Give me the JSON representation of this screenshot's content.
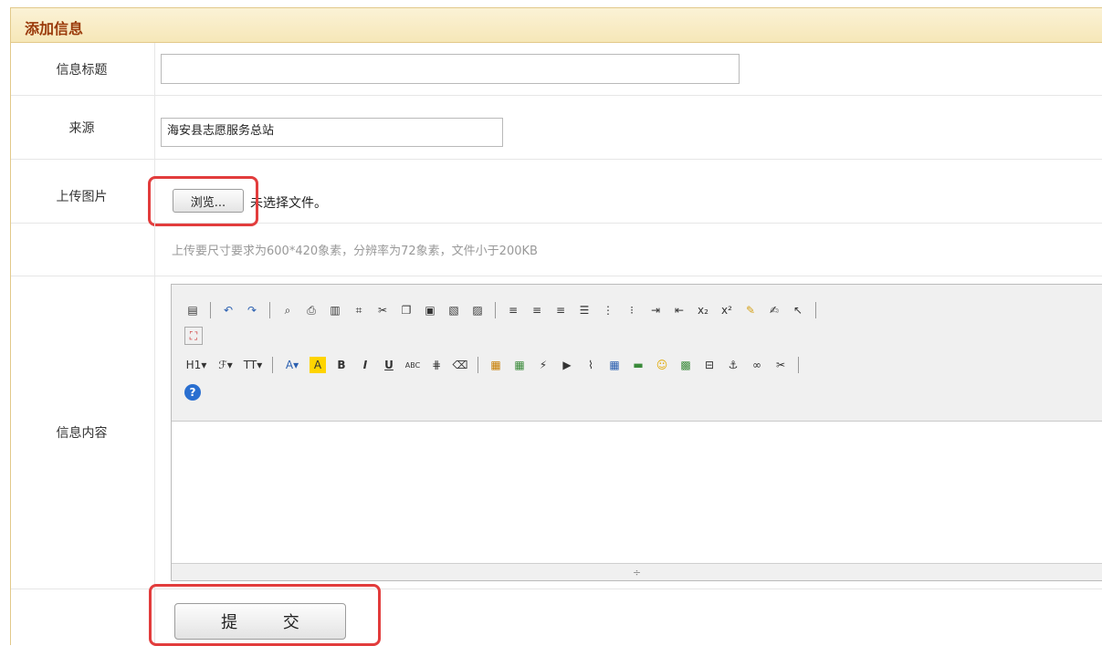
{
  "panel": {
    "title": "添加信息"
  },
  "form": {
    "title_label": "信息标题",
    "title_value": "",
    "source_label": "来源",
    "source_value": "海安县志愿服务总站",
    "upload_label": "上传图片",
    "browse_label": "浏览...",
    "file_status": "未选择文件。",
    "upload_hint": "上传要尺寸要求为600*420象素，分辨率为72象素，文件小于200KB",
    "content_label": "信息内容",
    "submit_label": "提 交"
  },
  "editor": {
    "toolbar_row1": [
      "source-icon",
      "undo-icon",
      "redo-icon",
      "preview-icon",
      "print-icon",
      "template-icon",
      "code-icon",
      "cut-icon",
      "copy-icon",
      "paste-icon",
      "paste-text-icon",
      "paste-word-icon",
      "align-left-icon",
      "align-center-icon",
      "align-right-icon",
      "justify-icon",
      "ordered-list-icon",
      "unordered-list-icon",
      "indent-icon",
      "outdent-icon",
      "subscript-icon",
      "superscript-icon",
      "clear-format-icon",
      "select-all-icon",
      "cursor-icon"
    ],
    "toolbar_row2": [
      "fullscreen-icon"
    ],
    "toolbar_row3": [
      "heading-icon",
      "font-family-icon",
      "font-size-icon",
      "font-color-icon",
      "highlight-color-icon",
      "bold-icon",
      "italic-icon",
      "underline-icon",
      "strikethrough-icon",
      "line-height-icon",
      "eraser-icon",
      "image-icon",
      "multi-image-icon",
      "flash-icon",
      "media-icon",
      "attachment-icon",
      "table-icon",
      "horizontal-rule-icon",
      "emoticon-icon",
      "map-icon",
      "page-break-icon",
      "anchor-icon",
      "link-icon",
      "unlink-icon"
    ],
    "toolbar_row4": [
      "help-icon"
    ],
    "resize_glyph": "÷"
  },
  "colors": {
    "title": "#9a3a0a",
    "highlight": "#e23c3c",
    "header_bg": "#f6e7b8"
  }
}
